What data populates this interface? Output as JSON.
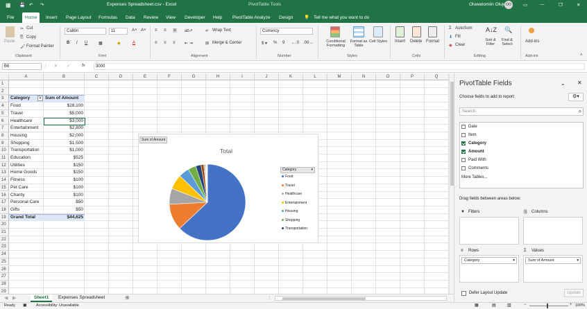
{
  "titlebar": {
    "filename": "Expenses Spreadsheet.csv - Excel",
    "context": "PivotTable Tools",
    "user": "Oluwatomiin Olujemi",
    "user_initials": "OO"
  },
  "tabs": [
    "File",
    "Home",
    "Insert",
    "Page Layout",
    "Formulas",
    "Data",
    "Review",
    "View",
    "Developer",
    "Help",
    "PivotTable Analyze",
    "Design"
  ],
  "tell_me": "Tell me what you want to do",
  "ribbon": {
    "cut": "Cut",
    "copy": "Copy",
    "format_painter": "Format Painter",
    "paste": "Paste",
    "clipboard": "Clipboard",
    "font_name": "Calibri",
    "font_size": "11",
    "font_group": "Font",
    "wrap_text": "Wrap Text",
    "merge_center": "Merge & Center",
    "alignment": "Alignment",
    "number_format": "Currency",
    "number": "Number",
    "conditional": "Conditional Formatting",
    "format_table": "Format as Table",
    "cell_styles": "Cell Styles",
    "styles": "Styles",
    "insert": "Insert",
    "delete": "Delete",
    "format": "Format",
    "cells": "Cells",
    "autosum": "AutoSum",
    "fill": "Fill",
    "clear": "Clear",
    "sort_filter": "Sort & Filter",
    "find_select": "Find & Select",
    "editing": "Editing",
    "addins": "Add-ins",
    "addins_group": "Add-ins"
  },
  "formula_bar": {
    "name_box": "B6",
    "fx": "fx",
    "value": "3000"
  },
  "columns": [
    "A",
    "B",
    "C",
    "D",
    "E",
    "F",
    "G",
    "H",
    "I",
    "J",
    "K",
    "L",
    "M",
    "N",
    "O",
    "P",
    "Q"
  ],
  "rows": [
    "1",
    "2",
    "3",
    "4",
    "5",
    "6",
    "7",
    "8",
    "9",
    "10",
    "11",
    "12",
    "13",
    "14",
    "15",
    "16",
    "17",
    "18",
    "19",
    "20",
    "21",
    "22",
    "23",
    "24",
    "25",
    "26",
    "27",
    "28",
    "29"
  ],
  "pivot": {
    "header_category": "Category",
    "header_amount": "Sum of Amount",
    "items": [
      {
        "category": "Food",
        "amount": "$28,100"
      },
      {
        "category": "Travel",
        "amount": "$5,000"
      },
      {
        "category": "Healthcare",
        "amount": "$3,000"
      },
      {
        "category": "Entertainment",
        "amount": "$2,800"
      },
      {
        "category": "Housing",
        "amount": "$2,000"
      },
      {
        "category": "Shopping",
        "amount": "$1,500"
      },
      {
        "category": "Transportation",
        "amount": "$1,000"
      },
      {
        "category": "Education",
        "amount": "$525"
      },
      {
        "category": "Utilities",
        "amount": "$150"
      },
      {
        "category": "Home Goods",
        "amount": "$150"
      },
      {
        "category": "Fitness",
        "amount": "$100"
      },
      {
        "category": "Pet Care",
        "amount": "$100"
      },
      {
        "category": "Charity",
        "amount": "$100"
      },
      {
        "category": "Personal Care",
        "amount": "$50"
      },
      {
        "category": "Gifts",
        "amount": "$50"
      }
    ],
    "grand_total_label": "Grand Total",
    "grand_total": "$44,625"
  },
  "chart_data": {
    "type": "pie",
    "title": "Total",
    "field_button": "Sum of Amount",
    "legend_title": "Category",
    "legend_position": "right",
    "categories": [
      "Food",
      "Travel",
      "Healthcare",
      "Entertainment",
      "Housing",
      "Shopping",
      "Transportation",
      "Education",
      "Utilities",
      "Home Goods",
      "Fitness",
      "Pet Care",
      "Charity",
      "Personal Care",
      "Gifts"
    ],
    "values": [
      28100,
      5000,
      3000,
      2800,
      2000,
      1500,
      1000,
      525,
      150,
      150,
      100,
      100,
      100,
      50,
      50
    ],
    "colors": [
      "#4472c4",
      "#ed7d31",
      "#a5a5a5",
      "#ffc000",
      "#5b9bd5",
      "#70ad47",
      "#264478",
      "#9e480e",
      "#636363",
      "#997300",
      "#255e91",
      "#43682b",
      "#698ed0",
      "#f1975a",
      "#b7b7b7"
    ],
    "legend_visible": [
      "Food",
      "Travel",
      "Healthcare",
      "Entertainment",
      "Housing",
      "Shopping",
      "Transportation"
    ]
  },
  "pane": {
    "title": "PivotTable Fields",
    "subtitle": "Choose fields to add to report:",
    "search_placeholder": "Search",
    "fields": [
      {
        "name": "Date",
        "checked": false
      },
      {
        "name": "Item",
        "checked": false
      },
      {
        "name": "Category",
        "checked": true
      },
      {
        "name": "Amount",
        "checked": true
      },
      {
        "name": "Paid With",
        "checked": false
      },
      {
        "name": "Comments",
        "checked": false
      }
    ],
    "more_tables": "More Tables...",
    "drag_label": "Drag fields between areas below:",
    "filters": "Filters",
    "columns": "Columns",
    "rows": "Rows",
    "values": "Values",
    "rows_field": "Category",
    "values_field": "Sum of Amount",
    "defer": "Defer Layout Update",
    "update": "Update"
  },
  "sheets": [
    "Sheet1",
    "Expenses Spreadsheet"
  ],
  "status": {
    "ready": "Ready",
    "accessibility": "Accessibility: Unavailable",
    "zoom": "100%"
  }
}
